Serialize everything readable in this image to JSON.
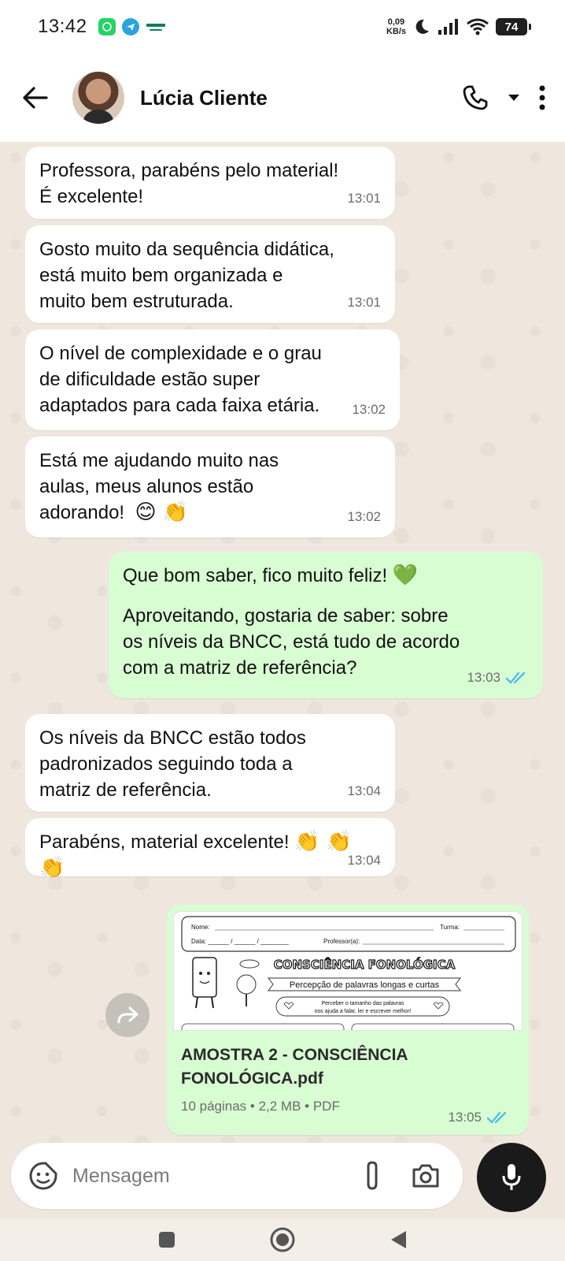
{
  "status_bar": {
    "time": "13:42",
    "net_speed_value": "0,09",
    "net_speed_unit": "KB/s",
    "battery": "74"
  },
  "header": {
    "contact_name": "Lúcia Cliente"
  },
  "messages": [
    {
      "direction": "incoming",
      "text": "Professora, parabéns pelo material!\nÉ excelente!",
      "time": "13:01"
    },
    {
      "direction": "incoming",
      "text": "Gosto muito da sequência didática,\nestá muito bem organizada e\nmuito bem estruturada.",
      "time": "13:01"
    },
    {
      "direction": "incoming",
      "text": "O nível de complexidade e o grau\nde dificuldade estão super\nadaptados para cada faixa etária.",
      "time": "13:02"
    },
    {
      "direction": "incoming",
      "text": "Está me ajudando muito nas\naulas, meus alunos estão\nadorando!",
      "emoji": "😊 👏",
      "time": "13:02"
    },
    {
      "direction": "outgoing",
      "text": "Que bom saber, fico muito feliz!",
      "emoji": "💚",
      "text2": "Aproveitando, gostaria de saber: sobre\nos níveis da BNCC, está tudo de acordo\ncom a matriz de referência?",
      "time": "13:03",
      "status": "read"
    },
    {
      "direction": "incoming",
      "text": "Os níveis da BNCC estão todos\npadronizados seguindo toda a\nmatriz de referência.",
      "time": "13:04"
    },
    {
      "direction": "incoming",
      "text": "Parabéns, material excelente!",
      "emoji": "👏 👏 👏",
      "time": "13:04"
    }
  ],
  "document": {
    "preview": {
      "nome_label": "Nome:",
      "turma_label": "Turma:",
      "data_label": "Data: ______ / ______ / ________",
      "professor_label": "Professor(a):",
      "heading": "CONSCIÊNCIA FONOLÓGICA",
      "subheading": "Percepção de palavras longas e curtas",
      "note_line1": "Perceber o tamanho das palavras",
      "note_line2": "nos ajuda a falar, ler e escrever melhor!"
    },
    "filename": "AMOSTRA 2 - CONSCIÊNCIA FONOLÓGICA.pdf",
    "meta": "10 páginas • 2,2 MB • PDF",
    "time": "13:05",
    "status": "read"
  },
  "input": {
    "placeholder": "Mensagem"
  },
  "colors": {
    "incoming_bubble": "#ffffff",
    "outgoing_bubble": "#d9fdd3",
    "read_ticks": "#53bdeb",
    "chat_background": "#efe7de"
  }
}
